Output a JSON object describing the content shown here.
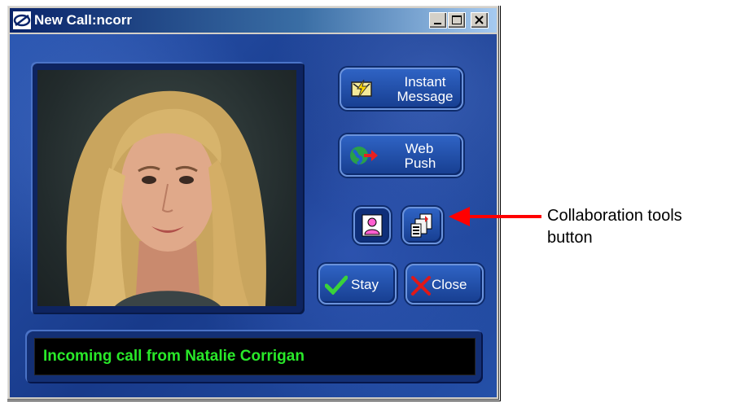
{
  "window": {
    "title": "New Call:ncorr"
  },
  "buttons": {
    "instant_message_line1": "Instant",
    "instant_message_line2": "Message",
    "web_push_line1": "Web",
    "web_push_line2": "Push",
    "stay_label": "Stay",
    "close_label": "Close"
  },
  "status": {
    "message": "Incoming call from Natalie Corrigan"
  },
  "annotation": {
    "line1": "Collaboration tools",
    "line2": "button"
  },
  "colors": {
    "status_text": "#29e829",
    "annotation_arrow": "#ff0000",
    "window_blue": "#1d3f8f"
  },
  "icons": {
    "app": "app-logo-icon",
    "instant_message": "instant-message-icon",
    "web_push": "web-push-globe-icon",
    "contact": "contact-person-icon",
    "collaboration": "collaboration-tools-icon",
    "stay": "checkmark-icon",
    "close": "red-x-icon"
  }
}
